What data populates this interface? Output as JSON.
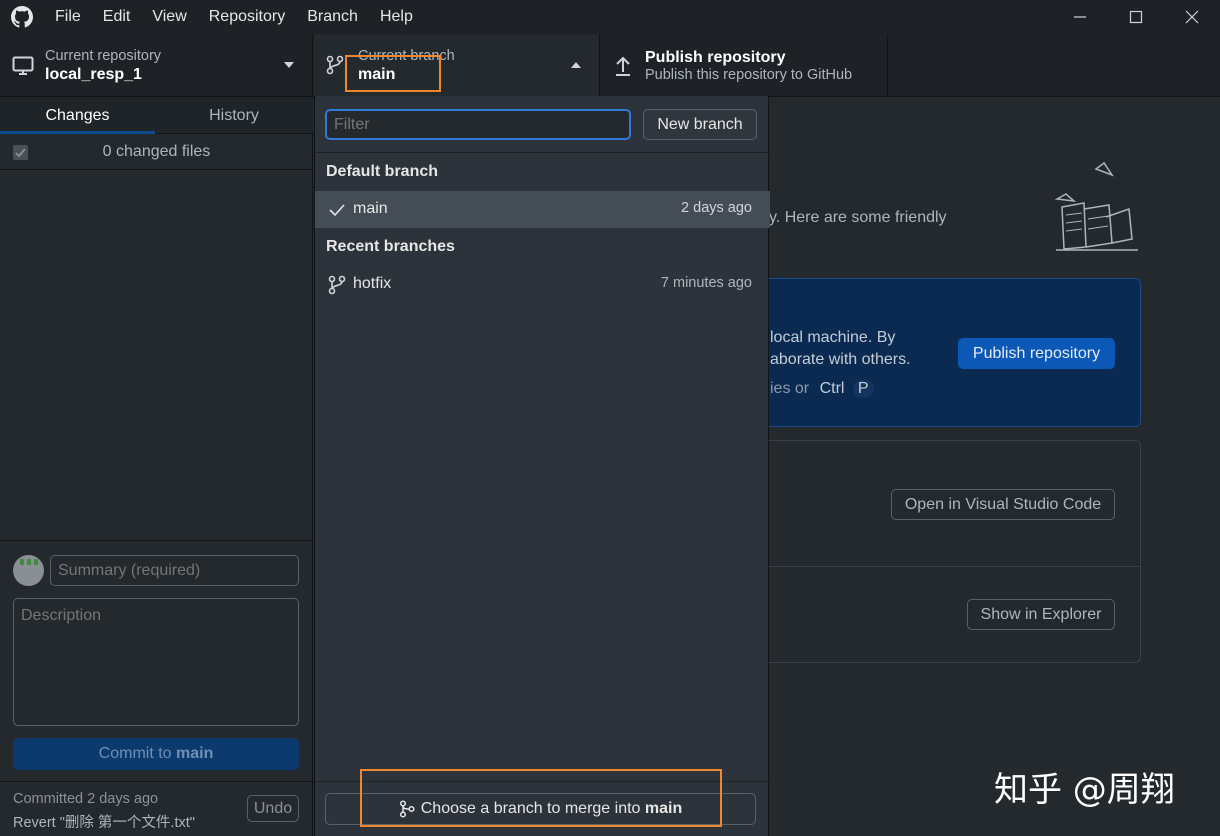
{
  "menu": [
    "File",
    "Edit",
    "View",
    "Repository",
    "Branch",
    "Help"
  ],
  "toolbar": {
    "repo_label": "Current repository",
    "repo_value": "local_resp_1",
    "branch_label": "Current branch",
    "branch_value": "main",
    "publish_title": "Publish repository",
    "publish_sub": "Publish this repository to GitHub"
  },
  "sidebar": {
    "tab_changes": "Changes",
    "tab_history": "History",
    "changed_files": "0 changed files",
    "summary_placeholder": "Summary (required)",
    "description_placeholder": "Description",
    "commit_prefix": "Commit to ",
    "commit_branch": "main",
    "last_commit": "Committed 2 days ago",
    "last_commit_msg": "Revert \"删除 第一个文件.txt\"",
    "undo_label": "Undo"
  },
  "dropdown": {
    "filter_placeholder": "Filter",
    "new_branch": "New branch",
    "default_heading": "Default branch",
    "default_branch": {
      "name": "main",
      "time": "2 days ago"
    },
    "recent_heading": "Recent branches",
    "recent_branches": [
      {
        "name": "hotfix",
        "time": "7 minutes ago"
      }
    ],
    "merge_prefix": "Choose a branch to merge into ",
    "merge_branch": "main"
  },
  "main": {
    "intro_text": "y. Here are some friendly",
    "publish_line1": "local machine. By",
    "publish_line2": "aborate with others.",
    "publish_line3": "ies or",
    "shortcut_key1": "Ctrl",
    "shortcut_key2": "P",
    "publish_button": "Publish repository",
    "open_vscode": "Open in Visual Studio Code",
    "show_explorer": "Show in Explorer"
  },
  "watermark": "知乎 @周翔",
  "colors": {
    "highlight_box": "#f0862f",
    "accent": "#0d4a8f",
    "primary_button": "#0b58b6"
  }
}
